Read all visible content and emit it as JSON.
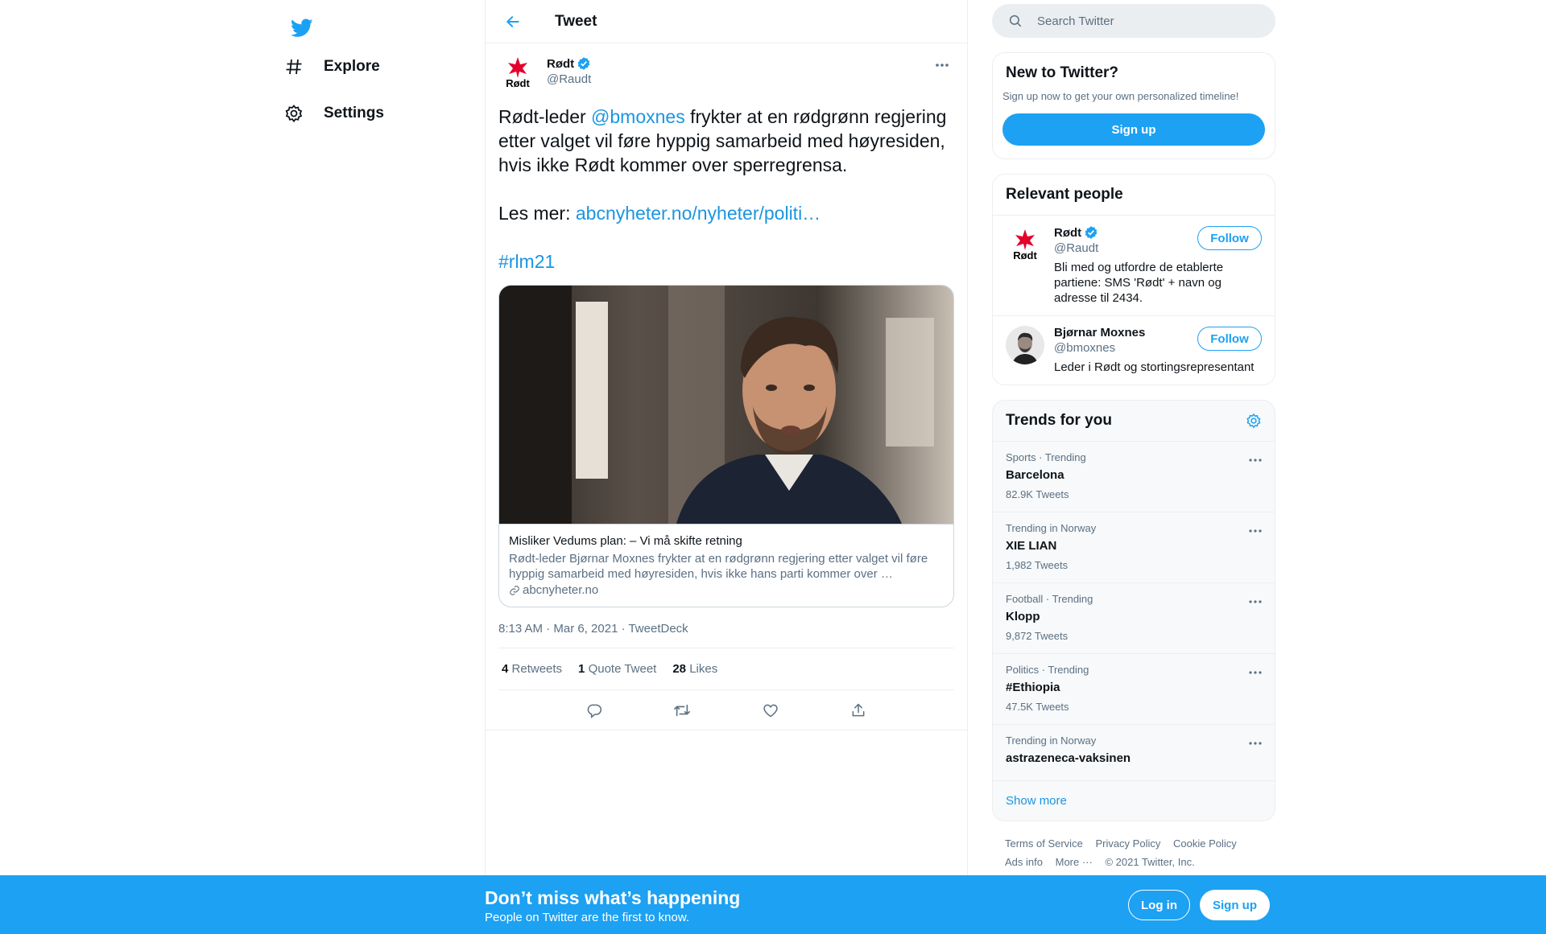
{
  "nav": {
    "explore_label": "Explore",
    "settings_label": "Settings"
  },
  "header": {
    "title": "Tweet"
  },
  "tweet": {
    "author_name": "Rødt",
    "author_handle": "@Raudt",
    "text_part1": "Rødt-leder ",
    "mention": "@bmoxnes",
    "text_part2": " frykter at en rødgrønn regjering etter valget vil føre hyppig samarbeid med høyresiden, hvis ikke Rødt kommer over sperregrensa.",
    "read_more_prefix": "Les mer: ",
    "link": "abcnyheter.no/nyheter/politi…",
    "hashtag": "#rlm21",
    "card": {
      "title": "Misliker Vedums plan: – Vi må skifte retning",
      "description": "Rødt-leder Bjørnar Moxnes frykter at en rødgrønn regjering etter valget vil føre hyppig samarbeid med høyresiden, hvis ikke hans parti kommer over …",
      "domain": "abcnyheter.no"
    },
    "timestamp": "8:13 AM · Mar 6, 2021 · TweetDeck",
    "stats": {
      "retweets_count": "4",
      "retweets_label": "Retweets",
      "quotes_count": "1",
      "quotes_label": "Quote Tweet",
      "likes_count": "28",
      "likes_label": "Likes"
    }
  },
  "search": {
    "placeholder": "Search Twitter"
  },
  "new_to_twitter": {
    "title": "New to Twitter?",
    "subtitle": "Sign up now to get your own personalized timeline!",
    "button": "Sign up"
  },
  "relevant": {
    "title": "Relevant people",
    "people": [
      {
        "name": "Rødt",
        "handle": "@Raudt",
        "bio": "Bli med og utfordre de etablerte partiene: SMS 'Rødt' + navn og adresse til 2434.",
        "button": "Follow"
      },
      {
        "name": "Bjørnar Moxnes",
        "handle": "@bmoxnes",
        "bio": "Leder i Rødt og stortingsrepresentant",
        "button": "Follow"
      }
    ]
  },
  "trends": {
    "title": "Trends for you",
    "items": [
      {
        "meta": "Sports · Trending",
        "name": "Barcelona",
        "count": "82.9K Tweets"
      },
      {
        "meta": "Trending in Norway",
        "name": "XIE LIAN",
        "count": "1,982 Tweets"
      },
      {
        "meta": "Football · Trending",
        "name": "Klopp",
        "count": "9,872 Tweets"
      },
      {
        "meta": "Politics · Trending",
        "name": "#Ethiopia",
        "count": "47.5K Tweets"
      },
      {
        "meta": "Trending in Norway",
        "name": "astrazeneca-vaksinen",
        "count": ""
      }
    ],
    "show_more": "Show more"
  },
  "footer": {
    "terms": "Terms of Service",
    "privacy": "Privacy Policy",
    "cookie": "Cookie Policy",
    "ads": "Ads info",
    "more": "More ···",
    "copyright": "© 2021 Twitter, Inc."
  },
  "bottom_bar": {
    "headline": "Don’t miss what’s happening",
    "sub": "People on Twitter are the first to know.",
    "login": "Log in",
    "signup": "Sign up"
  },
  "colors": {
    "accent": "#1da1f2",
    "link": "#1b95e0",
    "muted": "#5b7083",
    "brand_red": "#e4002b"
  }
}
